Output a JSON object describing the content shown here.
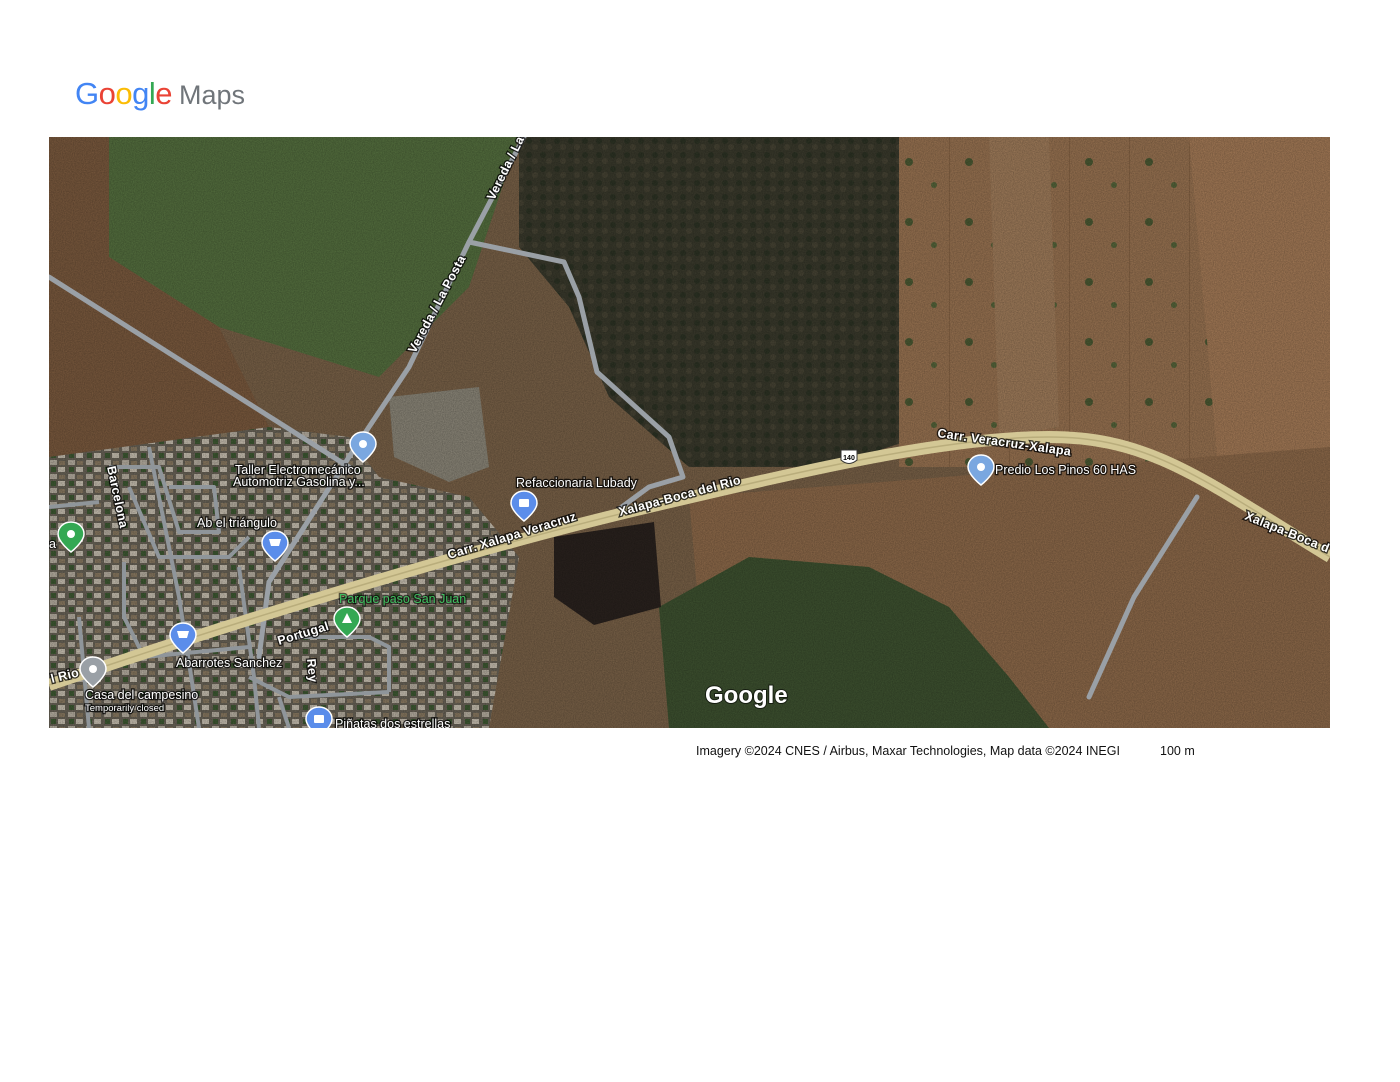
{
  "header": {
    "logo_letters": [
      {
        "ch": "G",
        "color": "#4285F4"
      },
      {
        "ch": "o",
        "color": "#EA4335"
      },
      {
        "ch": "o",
        "color": "#FBBC05"
      },
      {
        "ch": "g",
        "color": "#4285F4"
      },
      {
        "ch": "l",
        "color": "#34A853"
      },
      {
        "ch": "e",
        "color": "#EA4335"
      }
    ],
    "maps_label": "Maps"
  },
  "map": {
    "type": "satellite",
    "road_labels": {
      "vereda_top": "Vereda / La",
      "vereda_la_posta": "Vereda / La Posta",
      "carr_veracruz_xalapa": "Carr. Veracruz-Xalapa",
      "xalapa_boca_del_rio": "Xalapa-Boca del Rio",
      "carr_xalapa_veracruz": "Carr. Xalapa Veracruz",
      "xalapa_boca_right": "Xalapa-Boca d",
      "rio_left": "l Rio",
      "barcelona": "Barcelona",
      "portugal": "Portugal",
      "rey": "Rey",
      "route_shield": "140"
    },
    "pois": {
      "taller_line1": "Taller Electromecánico",
      "taller_line2": "Automotriz Gasolina y...",
      "refaccionaria": "Refaccionaria Lubady",
      "abarrotes_triangulo": "Ab el triángulo",
      "parque": "Parque paso San Juan",
      "abarrotes_sanchez": "Abarrotes Sanchez",
      "casa_campesino": "Casa del campesino",
      "casa_status": "Temporarily closed",
      "pinatas": "Piñatas dos estrellas",
      "predio": "Predio Los Pinos 60 HAS",
      "edge_left": "a"
    },
    "watermark": "Google"
  },
  "footer": {
    "attribution": "Imagery ©2024 CNES / Airbus, Maxar Technologies, Map data ©2024 INEGI",
    "scale": "100 m"
  }
}
